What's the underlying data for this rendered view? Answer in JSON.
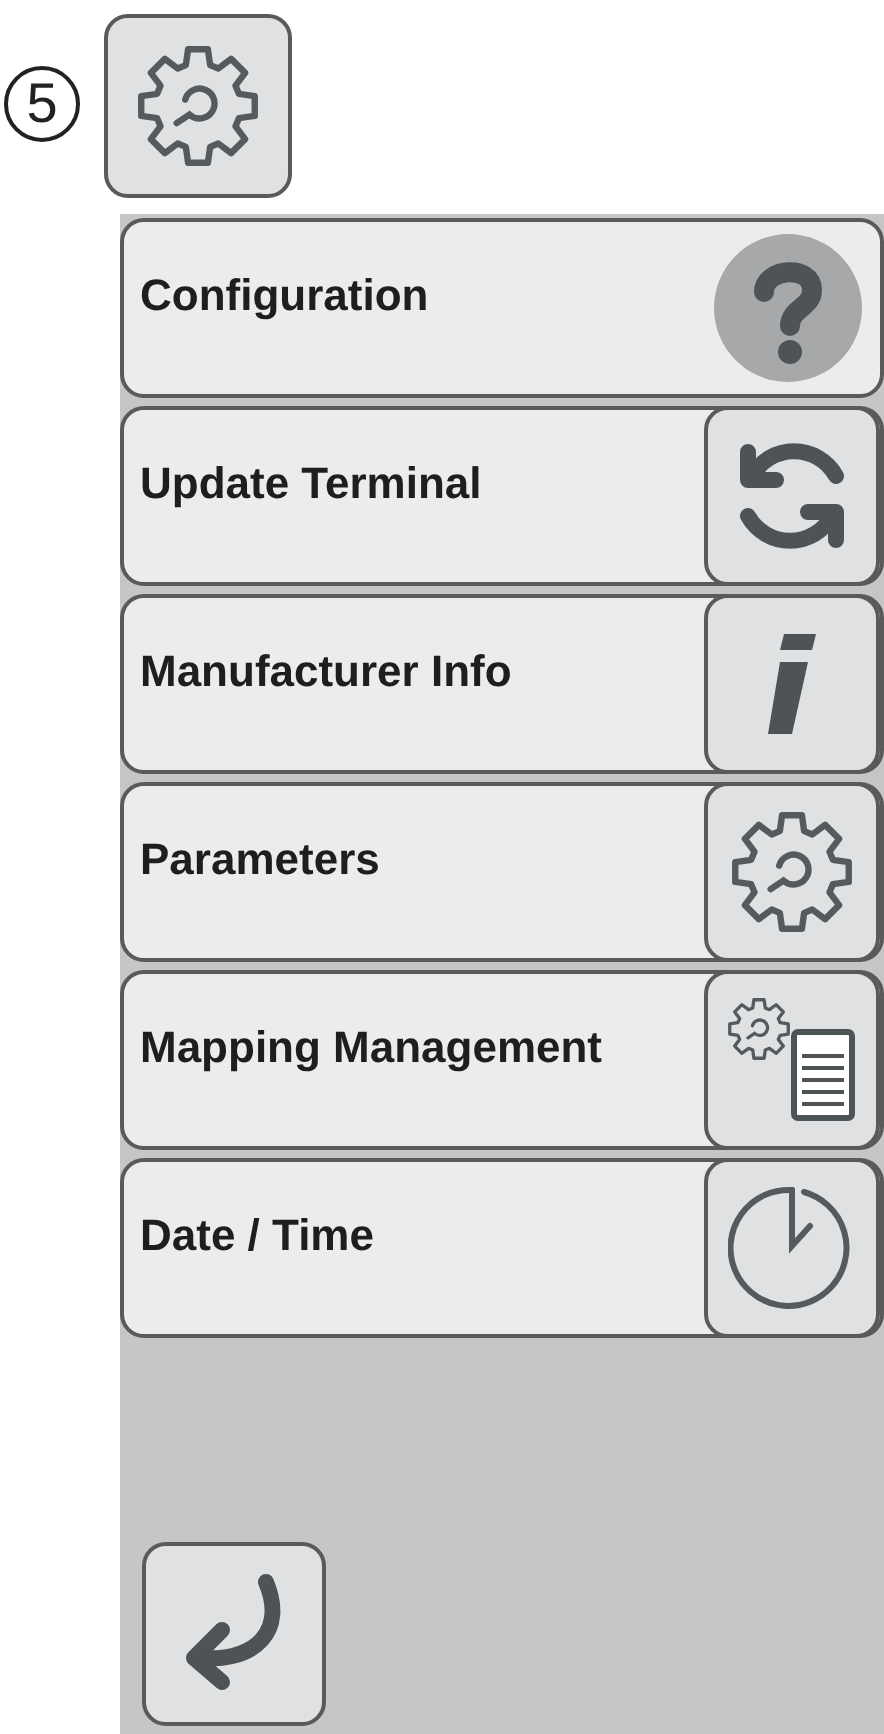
{
  "step_number": "5",
  "menu_items": [
    {
      "label": "Configuration",
      "kind": "help"
    },
    {
      "label": "Update Terminal",
      "kind": "sync"
    },
    {
      "label": "Manufacturer Info",
      "kind": "info"
    },
    {
      "label": "Parameters",
      "kind": "gear"
    },
    {
      "label": "Mapping Management",
      "kind": "mapping"
    },
    {
      "label": "Date / Time",
      "kind": "clock"
    }
  ]
}
